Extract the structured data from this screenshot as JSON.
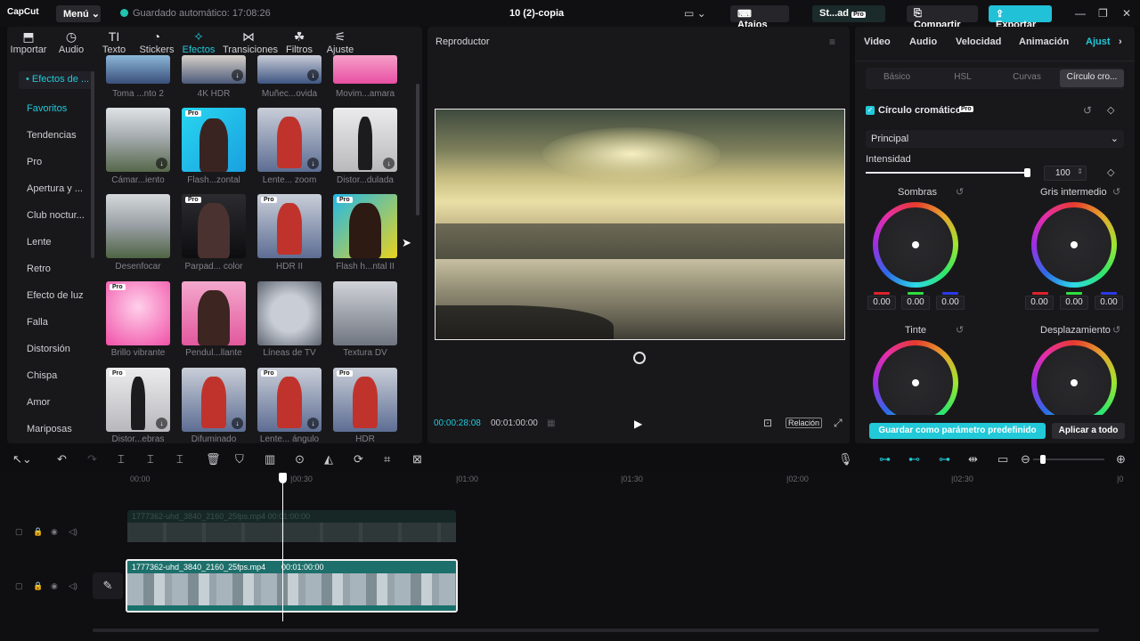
{
  "app": {
    "logo": "CapCut",
    "menu_label": "Menú",
    "autosave": "Guardado automático: 17:08:26",
    "project_title": "10 (2)-copia"
  },
  "header_buttons": {
    "studio": "St...ad",
    "studio_badge": "Pro",
    "shortcuts": "Atajos",
    "share": "Compartir",
    "export": "Exportar"
  },
  "media_tabs": [
    {
      "label": "Importar",
      "icon": "import-icon"
    },
    {
      "label": "Audio",
      "icon": "audio-icon"
    },
    {
      "label": "Texto",
      "icon": "text-icon"
    },
    {
      "label": "Stickers",
      "icon": "sticker-icon"
    },
    {
      "label": "Efectos",
      "icon": "effects-icon",
      "active": true
    },
    {
      "label": "Transiciones",
      "icon": "transition-icon"
    },
    {
      "label": "Filtros",
      "icon": "filter-icon"
    },
    {
      "label": "Ajuste",
      "icon": "adjust-icon"
    }
  ],
  "categories": [
    "• Efectos de ...",
    "Favoritos",
    "Tendencias",
    "Pro",
    "Apertura y ...",
    "Club noctur...",
    "Lente",
    "Retro",
    "Efecto de luz",
    "Falla",
    "Distorsión",
    "Chispa",
    "Amor",
    "Mariposas"
  ],
  "effects": [
    {
      "label": "Toma ...nto 2"
    },
    {
      "label": "4K HDR"
    },
    {
      "label": "Muñec...ovida"
    },
    {
      "label": "Movim...amara"
    },
    {
      "label": "Cámar...iento"
    },
    {
      "label": "Flash...zontal"
    },
    {
      "label": "Lente... zoom"
    },
    {
      "label": "Distor...dulada"
    },
    {
      "label": "Desenfocar"
    },
    {
      "label": "Parpad... color"
    },
    {
      "label": "HDR II"
    },
    {
      "label": "Flash h...ntal II"
    },
    {
      "label": "Brillo vibrante"
    },
    {
      "label": "Pendul...llante"
    },
    {
      "label": "Líneas de TV"
    },
    {
      "label": "Textura DV"
    },
    {
      "label": "Distor...ebras"
    },
    {
      "label": "Difuminado"
    },
    {
      "label": "Lente... ángulo"
    },
    {
      "label": "HDR"
    }
  ],
  "pro_badge": "Pro",
  "player": {
    "title": "Reproductor",
    "current_time": "00:00:28:08",
    "total_time": "00:01:00:00",
    "ratio_label": "Relación"
  },
  "inspector": {
    "tabs": [
      "Video",
      "Audio",
      "Velocidad",
      "Animación",
      "Ajust"
    ],
    "subtabs": [
      "Básico",
      "HSL",
      "Curvas",
      "Círculo cro..."
    ],
    "section_title": "Círculo cromático",
    "mode": "Principal",
    "intensity_label": "Intensidad",
    "intensity_value": "100",
    "intensity_fraction": 1.0,
    "wheels": [
      {
        "label": "Sombras",
        "r": "0.00",
        "g": "0.00",
        "b": "0.00"
      },
      {
        "label": "Gris intermedio",
        "r": "0.00",
        "g": "0.00",
        "b": "0.00"
      },
      {
        "label": "Tinte"
      },
      {
        "label": "Desplazamiento"
      }
    ],
    "save_preset": "Guardar como parámetro predefinido",
    "apply_all": "Aplicar a todo"
  },
  "timeline": {
    "ruler": [
      "00:00",
      "|00:30",
      "|01:00",
      "|01:30",
      "|02:00",
      "|02:30",
      "|0"
    ],
    "ghost_clip": "1777362-uhd_3840_2160_25fps.mp4   00:01:00:00",
    "clip_name": "1777362-uhd_3840_2160_25fps.mp4",
    "clip_duration": "00:01:00:00"
  },
  "colors": {
    "accent": "#22c9d8",
    "clip": "#1c6f6a"
  }
}
